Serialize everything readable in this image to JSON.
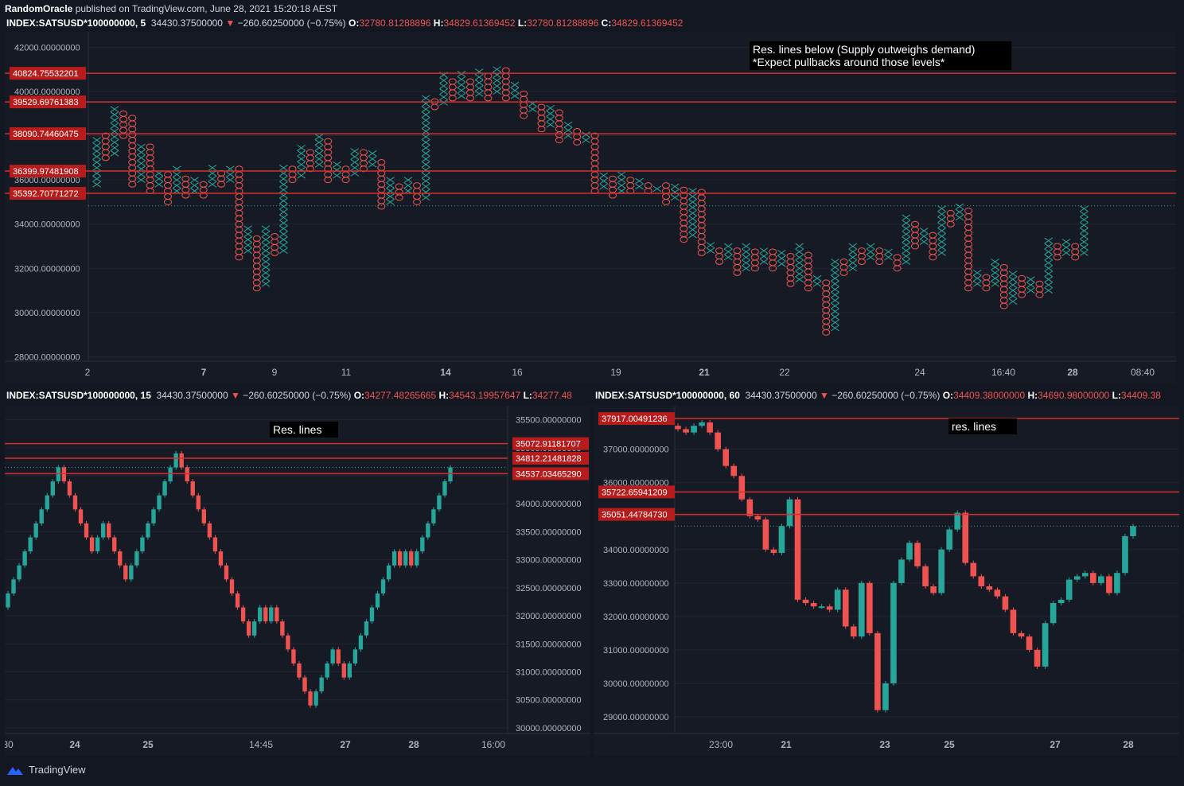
{
  "header": {
    "author": "RandomOracle",
    "published": "published on TradingView.com, June 28, 2021 15:20:18 AEST"
  },
  "chart_top": {
    "symbol": "INDEX:SATSUSD*100000000, 5",
    "last": "34430.37500000",
    "change": "−260.60250000 (−0.75%)",
    "o": "32780.81288896",
    "h": "34829.61369452",
    "l": "32780.81288896",
    "c": "34829.61369452",
    "note_line1": "Res. lines below (Supply outweighs demand)",
    "note_line2": "*Expect pullbacks around those levels*"
  },
  "chart_left": {
    "symbol": "INDEX:SATSUSD*100000000, 15",
    "last": "34430.37500000",
    "change": "−260.60250000 (−0.75%)",
    "o": "34277.48265665",
    "h": "34543.19957647",
    "l": "34277.48",
    "note": "Res. lines"
  },
  "chart_right": {
    "symbol": "INDEX:SATSUSD*100000000, 60",
    "last": "34430.37500000",
    "change": "−260.60250000 (−0.75%)",
    "o": "34409.38000000",
    "h": "34690.98000000",
    "l": "34409.38",
    "note": "res. lines"
  },
  "colors": {
    "up": "#26a69a",
    "down": "#ef5350",
    "line": "#d32f2f",
    "bg": "#161a25",
    "axis": "#b2b5be"
  },
  "footer": {
    "brand": "TradingView"
  },
  "chart_data": [
    {
      "type": "point-and-figure",
      "panel": "top",
      "y_ticks": [
        42000,
        40000,
        38000,
        36000,
        34000,
        32000,
        30000,
        28000
      ],
      "y_tick_labels": [
        "42000.00000000",
        "40000.00000000",
        "38000.00000000",
        "36000.00000000",
        "34000.00000000",
        "32000.00000000",
        "30000.00000000",
        "28000.00000000"
      ],
      "ylim": [
        27800,
        42700
      ],
      "x_tick_labels": [
        "2",
        "7",
        "9",
        "11",
        "14",
        "16",
        "19",
        "21",
        "22",
        "24",
        "16:40",
        "28",
        "08:40"
      ],
      "resistance": [
        40824.75532201,
        39529.69761383,
        38090.74460475,
        36399.97481908,
        35392.70771272
      ],
      "resistance_labels": [
        "40824.75532201",
        "39529.69761383",
        "38090.74460475",
        "36399.97481908",
        "35392.70771272"
      ],
      "last_price": 34829.61,
      "box_size": 250,
      "columns": [
        {
          "t": "X",
          "lo": 35800,
          "hi": 38000
        },
        {
          "t": "O",
          "lo": 37000,
          "hi": 38000
        },
        {
          "t": "X",
          "lo": 37200,
          "hi": 39300
        },
        {
          "t": "O",
          "lo": 38000,
          "hi": 39000
        },
        {
          "t": "O",
          "lo": 35800,
          "hi": 38800
        },
        {
          "t": "X",
          "lo": 36000,
          "hi": 37700
        },
        {
          "t": "O",
          "lo": 35500,
          "hi": 37500
        },
        {
          "t": "X",
          "lo": 35800,
          "hi": 36500
        },
        {
          "t": "O",
          "lo": 35000,
          "hi": 36300
        },
        {
          "t": "X",
          "lo": 35500,
          "hi": 36500
        },
        {
          "t": "O",
          "lo": 35300,
          "hi": 36200
        },
        {
          "t": "X",
          "lo": 35500,
          "hi": 36200
        },
        {
          "t": "O",
          "lo": 35300,
          "hi": 36000
        },
        {
          "t": "X",
          "lo": 35800,
          "hi": 36700
        },
        {
          "t": "O",
          "lo": 35800,
          "hi": 36500
        },
        {
          "t": "X",
          "lo": 36000,
          "hi": 36700
        },
        {
          "t": "O",
          "lo": 32500,
          "hi": 36500
        },
        {
          "t": "X",
          "lo": 32800,
          "hi": 33800
        },
        {
          "t": "O",
          "lo": 31100,
          "hi": 33500
        },
        {
          "t": "X",
          "lo": 31300,
          "hi": 33800
        },
        {
          "t": "O",
          "lo": 32700,
          "hi": 33500
        },
        {
          "t": "X",
          "lo": 32800,
          "hi": 36700
        },
        {
          "t": "O",
          "lo": 36000,
          "hi": 36500
        },
        {
          "t": "X",
          "lo": 36200,
          "hi": 37500
        },
        {
          "t": "O",
          "lo": 36500,
          "hi": 37300
        },
        {
          "t": "X",
          "lo": 36700,
          "hi": 38000
        },
        {
          "t": "O",
          "lo": 36000,
          "hi": 37800
        },
        {
          "t": "X",
          "lo": 36200,
          "hi": 36700
        },
        {
          "t": "O",
          "lo": 36000,
          "hi": 36700
        },
        {
          "t": "X",
          "lo": 36300,
          "hi": 37500
        },
        {
          "t": "O",
          "lo": 36500,
          "hi": 37300
        },
        {
          "t": "X",
          "lo": 36700,
          "hi": 37200
        },
        {
          "t": "O",
          "lo": 34800,
          "hi": 37000
        },
        {
          "t": "X",
          "lo": 35000,
          "hi": 36000
        },
        {
          "t": "O",
          "lo": 35200,
          "hi": 35800
        },
        {
          "t": "X",
          "lo": 35500,
          "hi": 36000
        },
        {
          "t": "O",
          "lo": 35000,
          "hi": 35800
        },
        {
          "t": "X",
          "lo": 35200,
          "hi": 39800
        },
        {
          "t": "O",
          "lo": 39300,
          "hi": 39700
        },
        {
          "t": "X",
          "lo": 39500,
          "hi": 40800
        },
        {
          "t": "O",
          "lo": 39700,
          "hi": 40600
        },
        {
          "t": "X",
          "lo": 39800,
          "hi": 40800
        },
        {
          "t": "O",
          "lo": 39700,
          "hi": 40600
        },
        {
          "t": "X",
          "lo": 39900,
          "hi": 41000
        },
        {
          "t": "O",
          "lo": 39700,
          "hi": 40800
        },
        {
          "t": "X",
          "lo": 40000,
          "hi": 41200
        },
        {
          "t": "O",
          "lo": 39700,
          "hi": 41000
        },
        {
          "t": "X",
          "lo": 39800,
          "hi": 40300
        },
        {
          "t": "O",
          "lo": 38900,
          "hi": 40100
        },
        {
          "t": "X",
          "lo": 39200,
          "hi": 39500
        },
        {
          "t": "O",
          "lo": 38300,
          "hi": 39300
        },
        {
          "t": "X",
          "lo": 38500,
          "hi": 39300
        },
        {
          "t": "O",
          "lo": 37800,
          "hi": 39200
        },
        {
          "t": "X",
          "lo": 38000,
          "hi": 38500
        },
        {
          "t": "O",
          "lo": 37700,
          "hi": 38300
        },
        {
          "t": "X",
          "lo": 37800,
          "hi": 38200
        },
        {
          "t": "O",
          "lo": 35500,
          "hi": 38000
        },
        {
          "t": "X",
          "lo": 35700,
          "hi": 36300
        },
        {
          "t": "O",
          "lo": 35300,
          "hi": 36100
        },
        {
          "t": "X",
          "lo": 35500,
          "hi": 36300
        },
        {
          "t": "O",
          "lo": 35500,
          "hi": 36100
        },
        {
          "t": "X",
          "lo": 35700,
          "hi": 36000
        },
        {
          "t": "O",
          "lo": 35500,
          "hi": 35900
        },
        {
          "t": "X",
          "lo": 35600,
          "hi": 35800
        },
        {
          "t": "O",
          "lo": 35000,
          "hi": 35800
        },
        {
          "t": "X",
          "lo": 35200,
          "hi": 35800
        },
        {
          "t": "O",
          "lo": 33300,
          "hi": 35600
        },
        {
          "t": "X",
          "lo": 33500,
          "hi": 35700
        },
        {
          "t": "O",
          "lo": 32700,
          "hi": 35500
        },
        {
          "t": "X",
          "lo": 32800,
          "hi": 33200
        },
        {
          "t": "O",
          "lo": 32300,
          "hi": 33000
        },
        {
          "t": "X",
          "lo": 32500,
          "hi": 33200
        },
        {
          "t": "O",
          "lo": 31800,
          "hi": 33000
        },
        {
          "t": "X",
          "lo": 32000,
          "hi": 33000
        },
        {
          "t": "O",
          "lo": 32000,
          "hi": 32800
        },
        {
          "t": "X",
          "lo": 32300,
          "hi": 33000
        },
        {
          "t": "O",
          "lo": 32000,
          "hi": 32800
        },
        {
          "t": "X",
          "lo": 32200,
          "hi": 32800
        },
        {
          "t": "O",
          "lo": 31300,
          "hi": 32600
        },
        {
          "t": "X",
          "lo": 31500,
          "hi": 33000
        },
        {
          "t": "O",
          "lo": 31100,
          "hi": 32800
        },
        {
          "t": "X",
          "lo": 31300,
          "hi": 31700
        },
        {
          "t": "O",
          "lo": 29100,
          "hi": 31500
        },
        {
          "t": "X",
          "lo": 29300,
          "hi": 32500
        },
        {
          "t": "O",
          "lo": 31800,
          "hi": 32300
        },
        {
          "t": "X",
          "lo": 32000,
          "hi": 33000
        },
        {
          "t": "O",
          "lo": 32300,
          "hi": 32800
        },
        {
          "t": "X",
          "lo": 32500,
          "hi": 33200
        },
        {
          "t": "O",
          "lo": 32300,
          "hi": 33000
        },
        {
          "t": "X",
          "lo": 32500,
          "hi": 32800
        },
        {
          "t": "O",
          "lo": 32000,
          "hi": 32600
        },
        {
          "t": "X",
          "lo": 32300,
          "hi": 34300
        },
        {
          "t": "O",
          "lo": 33000,
          "hi": 34000
        },
        {
          "t": "X",
          "lo": 33200,
          "hi": 33700
        },
        {
          "t": "O",
          "lo": 32500,
          "hi": 33500
        },
        {
          "t": "X",
          "lo": 32700,
          "hi": 34700
        },
        {
          "t": "O",
          "lo": 34000,
          "hi": 34500
        },
        {
          "t": "X",
          "lo": 34300,
          "hi": 35000
        },
        {
          "t": "O",
          "lo": 31100,
          "hi": 34800
        },
        {
          "t": "X",
          "lo": 31300,
          "hi": 31800
        },
        {
          "t": "O",
          "lo": 31100,
          "hi": 31800
        },
        {
          "t": "X",
          "lo": 31300,
          "hi": 32300
        },
        {
          "t": "O",
          "lo": 30300,
          "hi": 32100
        },
        {
          "t": "X",
          "lo": 30500,
          "hi": 31800
        },
        {
          "t": "O",
          "lo": 30800,
          "hi": 31600
        },
        {
          "t": "X",
          "lo": 31000,
          "hi": 31500
        },
        {
          "t": "O",
          "lo": 30800,
          "hi": 31300
        },
        {
          "t": "X",
          "lo": 31000,
          "hi": 33300
        },
        {
          "t": "O",
          "lo": 32500,
          "hi": 33100
        },
        {
          "t": "X",
          "lo": 32700,
          "hi": 33300
        },
        {
          "t": "O",
          "lo": 32500,
          "hi": 33100
        },
        {
          "t": "X",
          "lo": 32700,
          "hi": 34800
        }
      ]
    },
    {
      "type": "candlestick",
      "panel": "bottom-left",
      "y_ticks": [
        35500,
        35000,
        34500,
        34000,
        33500,
        33000,
        32500,
        32000,
        31500,
        31000,
        30500,
        30000
      ],
      "y_tick_labels": [
        "35500.00000000",
        "35000.00000000",
        "34500.00000000",
        "34000.00000000",
        "33500.00000000",
        "33000.00000000",
        "32500.00000000",
        "32000.00000000",
        "31500.00000000",
        "31000.00000000",
        "30500.00000000",
        "30000.00000000"
      ],
      "ylim": [
        29900,
        35750
      ],
      "x_tick_labels": [
        "30",
        "24",
        "25",
        "14:45",
        "27",
        "28",
        "16:00"
      ],
      "resistance": [
        35072.91181707,
        34812.21481828,
        34537.0346529
      ],
      "resistance_labels": [
        "35072.91181707",
        "34812.21481828",
        "34537.03465290"
      ],
      "closes": [
        32400,
        32650,
        32900,
        33150,
        33400,
        33650,
        33900,
        34150,
        34400,
        34650,
        34400,
        34150,
        33900,
        33650,
        33400,
        33150,
        33400,
        33650,
        33400,
        33150,
        32900,
        32650,
        32900,
        33150,
        33400,
        33650,
        33900,
        34150,
        34400,
        34650,
        34900,
        34650,
        34400,
        34150,
        33900,
        33650,
        33400,
        33150,
        32900,
        32650,
        32400,
        32150,
        31900,
        31650,
        31900,
        32150,
        31900,
        32150,
        31900,
        31650,
        31400,
        31150,
        30900,
        30650,
        30400,
        30650,
        30900,
        31150,
        31400,
        31150,
        30900,
        31150,
        31400,
        31650,
        31900,
        32150,
        32400,
        32650,
        32900,
        33150,
        32900,
        33150,
        32900,
        33150,
        33400,
        33650,
        33900,
        34150,
        34400,
        34650
      ],
      "open": 32150
    },
    {
      "type": "candlestick",
      "panel": "bottom-right",
      "y_ticks": [
        37000,
        36000,
        35000,
        34000,
        33000,
        32000,
        31000,
        30000,
        29000
      ],
      "y_tick_labels": [
        "37000.00000000",
        "36000.00000000",
        "35000.00000000",
        "34000.00000000",
        "33000.00000000",
        "32000.00000000",
        "31000.00000000",
        "30000.00000000",
        "29000.00000000"
      ],
      "ylim": [
        28500,
        38300
      ],
      "x_tick_labels": [
        "23:00",
        "21",
        "23",
        "25",
        "27",
        "28"
      ],
      "resistance": [
        37917.00491236,
        35722.65941209,
        35051.4478473
      ],
      "resistance_labels": [
        "37917.00491236",
        "35722.65941209",
        "35051.44784730"
      ],
      "closes": [
        37600,
        37500,
        37700,
        37800,
        37500,
        37000,
        36500,
        36200,
        35500,
        35000,
        34900,
        34000,
        33900,
        34700,
        35500,
        32500,
        32400,
        32300,
        32300,
        32200,
        32800,
        31700,
        31400,
        33000,
        31500,
        29200,
        30000,
        33000,
        33700,
        34200,
        33500,
        32900,
        32700,
        34000,
        34600,
        35100,
        33600,
        33200,
        32900,
        32800,
        32600,
        32200,
        31500,
        31400,
        31000,
        30500,
        31800,
        32400,
        32500,
        33100,
        33200,
        33300,
        33000,
        33200,
        32700,
        33300,
        34400,
        34700
      ],
      "open": 37700
    }
  ]
}
